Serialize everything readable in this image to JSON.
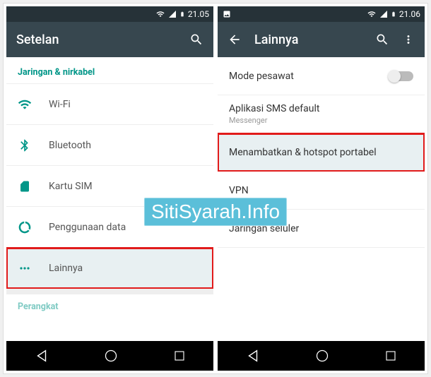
{
  "watermark": "SitiSyarah.Info",
  "left": {
    "status": {
      "time": "21.05"
    },
    "appbar": {
      "title": "Setelan"
    },
    "section_header": "Jaringan & nirkabel",
    "items": [
      {
        "label": "Wi-Fi"
      },
      {
        "label": "Bluetooth"
      },
      {
        "label": "Kartu SIM"
      },
      {
        "label": "Penggunaan data"
      },
      {
        "label": "Lainnya"
      }
    ],
    "next_section": "Perangkat"
  },
  "right": {
    "status": {
      "time": "21.06"
    },
    "appbar": {
      "title": "Lainnya"
    },
    "items": [
      {
        "label": "Mode pesawat"
      },
      {
        "label": "Aplikasi SMS default",
        "sub": "Messenger"
      },
      {
        "label": "Menambatkan & hotspot portabel"
      },
      {
        "label": "VPN"
      },
      {
        "label": "Jaringan seluler"
      }
    ]
  }
}
